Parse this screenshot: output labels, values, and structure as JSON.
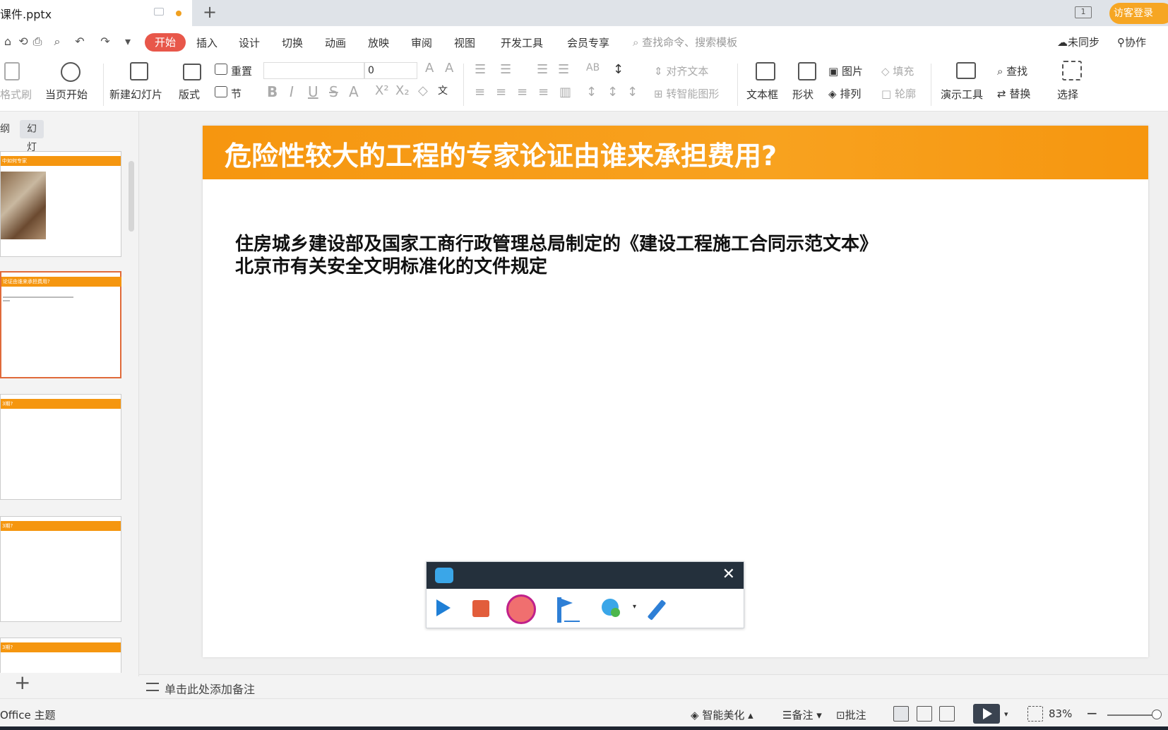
{
  "titlebar": {
    "file_name": "课件.pptx",
    "login_label": "访客登录",
    "window_count": "1"
  },
  "menubar": {
    "items": [
      "开始",
      "插入",
      "设计",
      "切换",
      "动画",
      "放映",
      "审阅",
      "视图",
      "开发工具",
      "会员专享"
    ],
    "active": "开始",
    "search_placeholder": "查找命令、搜索模板",
    "sync_label": "未同步",
    "collab_label": "协作"
  },
  "ribbon": {
    "format_painter": "格式刷",
    "from_current": "当页开始",
    "new_slide": "新建幻灯片",
    "layout": "版式",
    "reset": "重置",
    "section": "节",
    "font_size_value": "0",
    "align_text": "对齐文本",
    "smartart": "转智能图形",
    "textbox": "文本框",
    "shape": "形状",
    "picture": "图片",
    "arrange": "排列",
    "fill": "填充",
    "outline": "轮廓",
    "present_tools": "演示工具",
    "find": "查找",
    "replace": "替换",
    "select": "选择"
  },
  "leftpanel": {
    "tab_outline": "纲",
    "tab_slides": "幻灯片",
    "thumbs": [
      {
        "title": "中如何专家"
      },
      {
        "title": "论证由谁来承担费用?"
      },
      {
        "title": "3期?"
      },
      {
        "title": "3期?"
      },
      {
        "title": "3期?"
      }
    ]
  },
  "slide": {
    "title": "危险性较大的工程的专家论证由谁来承担费用?",
    "line1": "住房城乡建设部及国家工商行政管理总局制定的《建设工程施工合同示范文本》",
    "line2": "北京市有关安全文明标准化的文件规定"
  },
  "notes": {
    "placeholder": "单击此处添加备注"
  },
  "statusbar": {
    "theme": "Office 主题",
    "beautify": "智能美化",
    "notes": "备注",
    "comments": "批注",
    "zoom": "83%"
  },
  "colors": {
    "accent": "#e8574a",
    "slide_header": "#f6960f",
    "login": "#f6a623"
  }
}
